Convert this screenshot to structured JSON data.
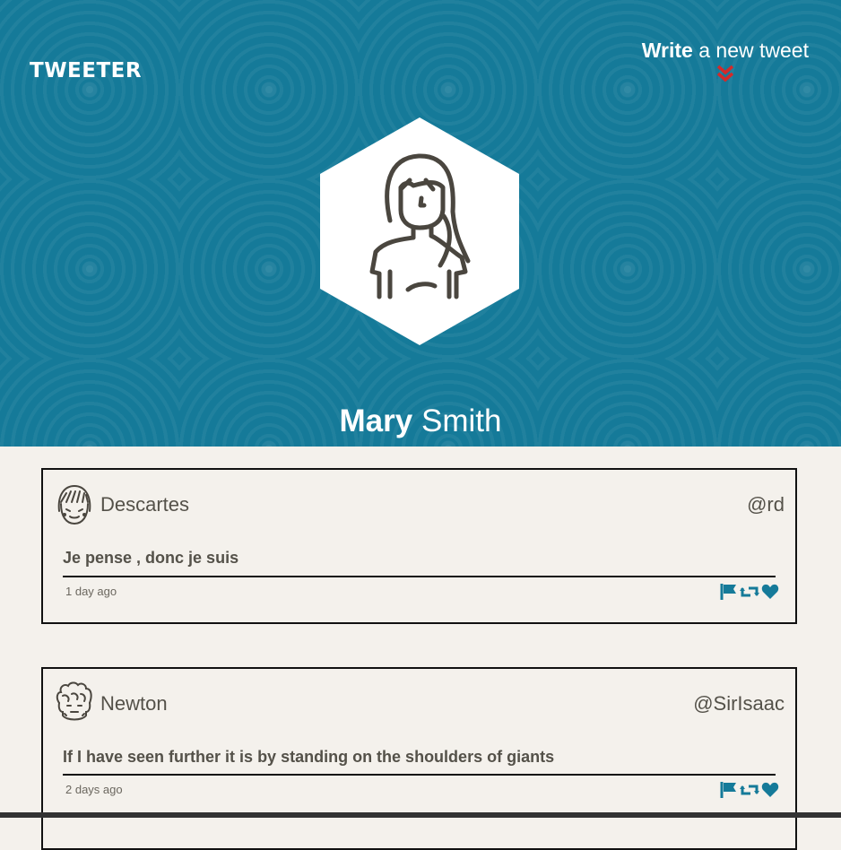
{
  "header": {
    "brand": "TWEETER",
    "compose": {
      "bold": "Write",
      "rest": "a new tweet"
    },
    "profile": {
      "first_name": "Mary",
      "last_name": "Smith"
    }
  },
  "colors": {
    "header_bg": "#157a99",
    "accent": "#157a99",
    "chevron": "#d32a2a",
    "page_bg": "#f4f1ec"
  },
  "tweets": [
    {
      "name": "Descartes",
      "handle": "@rd",
      "text": "Je pense , donc je suis",
      "time": "1 day ago",
      "avatar_icon": "bangs-face-icon"
    },
    {
      "name": "Newton",
      "handle": "@SirIsaac",
      "text": "If I have seen further it is by standing on the shoulders of giants",
      "time": "2 days ago",
      "avatar_icon": "curly-hair-face-icon"
    }
  ],
  "actions": [
    "flag-icon",
    "retweet-icon",
    "heart-icon"
  ]
}
